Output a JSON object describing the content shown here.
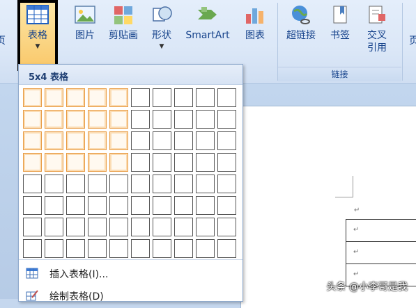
{
  "ribbon": {
    "partial_left_label": "页",
    "table_button_label": "表格",
    "buttons": [
      {
        "label": "图片",
        "icon": "picture-icon"
      },
      {
        "label": "剪贴画",
        "icon": "clipart-icon"
      },
      {
        "label": "形状",
        "icon": "shapes-icon"
      },
      {
        "label": "SmartArt",
        "icon": "smartart-icon"
      },
      {
        "label": "图表",
        "icon": "chart-icon"
      },
      {
        "label": "超链接",
        "icon": "hyperlink-icon"
      },
      {
        "label": "书签",
        "icon": "bookmark-icon"
      },
      {
        "label": "交叉\n引用",
        "icon": "crossref-icon"
      }
    ],
    "links_group_label": "链接",
    "partial_right_label": "页"
  },
  "dropdown": {
    "title": "5x4 表格",
    "grid": {
      "columns": 10,
      "rows": 8,
      "selected_columns": 5,
      "selected_rows": 4
    },
    "menu": [
      {
        "label": "插入表格(I)...",
        "icon": "insert-table-icon"
      },
      {
        "label": "绘制表格(D)",
        "icon": "draw-table-icon"
      }
    ]
  },
  "document": {
    "paragraph_mark": "↵"
  },
  "watermark": "头条 @小李哥是我"
}
